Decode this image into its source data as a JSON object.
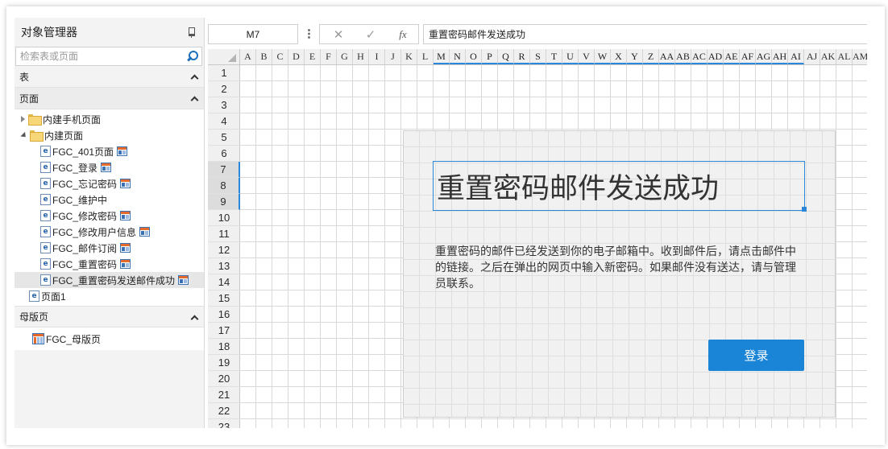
{
  "panel": {
    "title": "对象管理器",
    "search_placeholder": "检索表或页面",
    "sections": {
      "tables": "表",
      "pages": "页面",
      "masters": "母版页"
    },
    "pages_tree": {
      "mobile_folder": "内建手机页面",
      "builtin_folder": "内建页面",
      "items": [
        "FGC_401页面",
        "FGC_登录",
        "FGC_忘记密码",
        "FGC_维护中",
        "FGC_修改密码",
        "FGC_修改用户信息",
        "FGC_邮件订阅",
        "FGC_重置密码",
        "FGC_重置密码发送邮件成功"
      ],
      "page1": "页面1"
    },
    "master_item": "FGC_母版页"
  },
  "formula": {
    "cell_ref": "M7",
    "cancel_symbol": "✕",
    "confirm_symbol": "✓",
    "fx_symbol": "fx",
    "value": "重置密码邮件发送成功"
  },
  "grid": {
    "columns": [
      "A",
      "B",
      "C",
      "D",
      "E",
      "F",
      "G",
      "H",
      "I",
      "J",
      "K",
      "L",
      "M",
      "N",
      "O",
      "P",
      "Q",
      "R",
      "S",
      "T",
      "U",
      "V",
      "W",
      "X",
      "Y",
      "Z",
      "AA",
      "AB",
      "AC",
      "AD",
      "AE",
      "AF",
      "AG",
      "AH",
      "AI",
      "AJ",
      "AK",
      "AL",
      "AM"
    ],
    "rows": [
      "1",
      "2",
      "3",
      "4",
      "5",
      "6",
      "7",
      "8",
      "9",
      "10",
      "11",
      "12",
      "13",
      "14",
      "15",
      "16",
      "17",
      "18",
      "19",
      "20",
      "21",
      "22",
      "23"
    ],
    "accent_color": "#2b88d8"
  },
  "content": {
    "title": "重置密码邮件发送成功",
    "message": "重置密码的邮件已经发送到你的电子邮箱中。收到邮件后，请点击邮件中的链接。之后在弹出的网页中输入新密码。如果邮件没有送达，请与管理员联系。",
    "login_label": "登录",
    "button_color": "#1a84d6"
  }
}
